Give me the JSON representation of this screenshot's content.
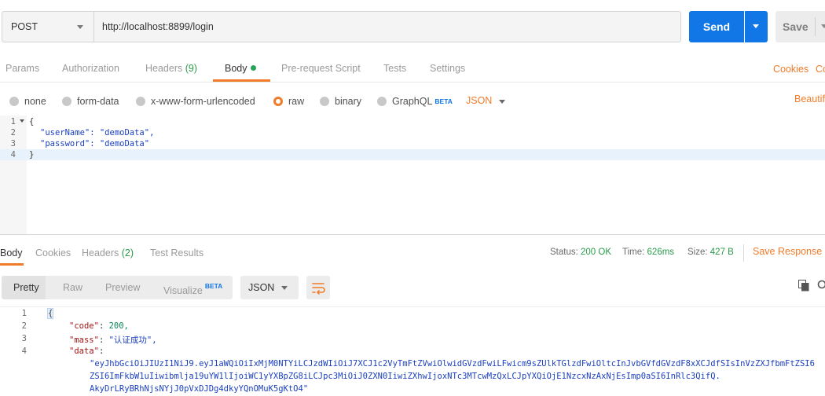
{
  "request": {
    "method": "POST",
    "url": "http://localhost:8899/login",
    "send_label": "Send",
    "save_label": "Save"
  },
  "request_tabs": {
    "params": "Params",
    "authorization": "Authorization",
    "headers": "Headers",
    "headers_count": "(9)",
    "body": "Body",
    "pre_request": "Pre-request Script",
    "tests": "Tests",
    "settings": "Settings",
    "cookies": "Cookies",
    "code_partial": "Co"
  },
  "body_types": {
    "none": "none",
    "form_data": "form-data",
    "urlencoded": "x-www-form-urlencoded",
    "raw": "raw",
    "binary": "binary",
    "graphql": "GraphQL",
    "graphql_badge": "BETA",
    "format": "JSON",
    "beautify": "Beautif"
  },
  "request_body": {
    "line_numbers": [
      "1",
      "2",
      "3",
      "4"
    ],
    "lines": [
      "{",
      "\"userName\": \"demoData\",",
      "\"password\": \"demoData\"",
      "}"
    ]
  },
  "response_tabs": {
    "body": "Body",
    "cookies": "Cookies",
    "headers": "Headers",
    "headers_count": "(2)",
    "test_results": "Test Results"
  },
  "response_status": {
    "status_label": "Status:",
    "status_value": "200 OK",
    "time_label": "Time:",
    "time_value": "626ms",
    "size_label": "Size:",
    "size_value": "427 B",
    "save_response": "Save Response",
    "clear_partial": "C"
  },
  "response_view": {
    "pretty": "Pretty",
    "raw": "Raw",
    "preview": "Preview",
    "visualize": "Visualize",
    "visualize_badge": "BETA",
    "format": "JSON"
  },
  "response_body": {
    "line_numbers": [
      "1",
      "2",
      "3",
      "4"
    ],
    "open_brace": "{",
    "code_key": "\"code\"",
    "code_value": "200,",
    "mass_key": "\"mass\"",
    "mass_value": "\"认证成功\",",
    "data_key": "\"data\"",
    "data_line1": "\"eyJhbGciOiJIUzI1NiJ9.eyJ1aWQiOiIxMjM0NTYiLCJzdWIiOiJ7XCJ1c2VyTmFtZVwiOlwidGVzdFwiLFwicm9sZUlkTGlzdFwiOltcInJvbGVfdGVzdF8xXCJdfSIsInVzZXJfbmFtZSI6",
    "data_line2": "ZSI6ImFkbW1uIiwibmlja19uYW1lIjoiWC1yYXBpZG8iLCJpc3MiOiJ0ZXN0IiwiZXhwIjoxNTc3MTcwMzQxLCJpYXQiOjE1NzcxNzAxNjEsImp0aSI6InRlc3QifQ.",
    "data_line3": "AkyDrLRyBRhNjsNYjJ0pVxDJDg4dkyYQnOMuK5gKtO4\""
  },
  "colors": {
    "accent": "#f07c2a",
    "send_blue": "#1177e6",
    "status_green": "#2a9a4a"
  },
  "icons": [
    "chevron-down-icon",
    "wrap-lines-icon",
    "copy-icon",
    "search-icon"
  ]
}
